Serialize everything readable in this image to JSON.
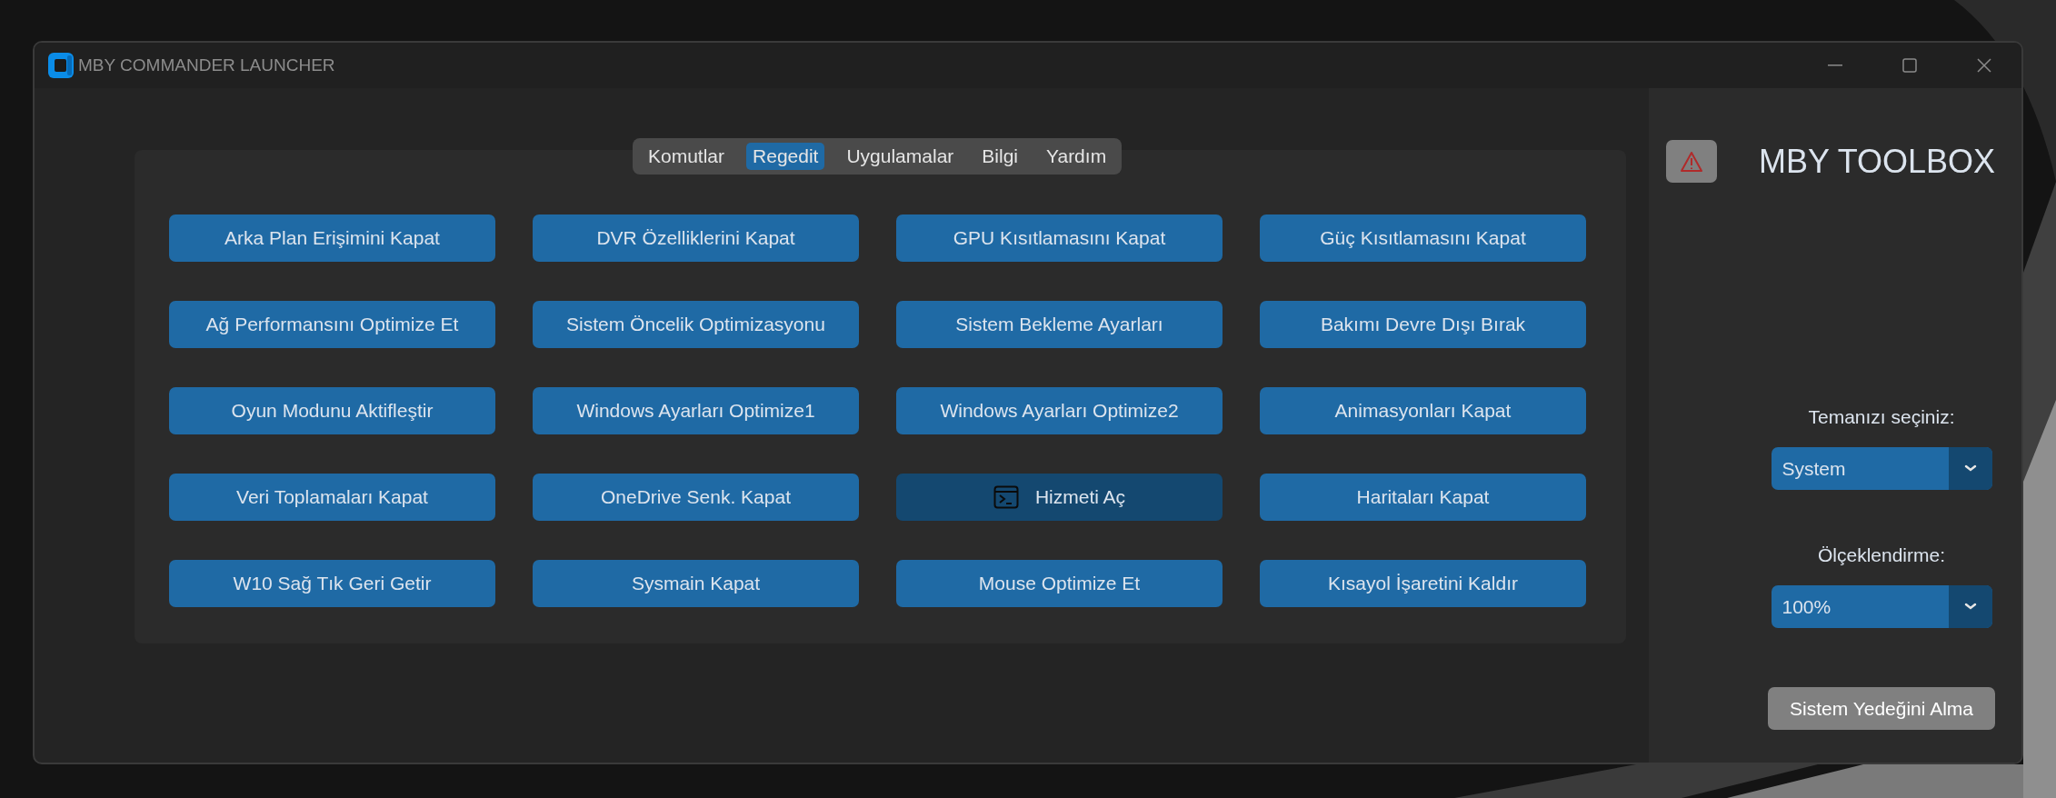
{
  "window": {
    "title": "MBY COMMANDER LAUNCHER"
  },
  "tabs": [
    {
      "label": "Komutlar",
      "selected": false
    },
    {
      "label": "Regedit",
      "selected": true
    },
    {
      "label": "Uygulamalar",
      "selected": false
    },
    {
      "label": "Bilgi",
      "selected": false
    },
    {
      "label": "Yardım",
      "selected": false
    }
  ],
  "buttons": [
    {
      "label": "Arka Plan Erişimini Kapat",
      "kind": "text",
      "highlighted": false
    },
    {
      "label": "DVR Özelliklerini Kapat",
      "kind": "text",
      "highlighted": false
    },
    {
      "label": "GPU Kısıtlamasını Kapat",
      "kind": "text",
      "highlighted": false
    },
    {
      "label": "Güç Kısıtlamasını Kapat",
      "kind": "text",
      "highlighted": false
    },
    {
      "label": "Ağ Performansını Optimize Et",
      "kind": "text",
      "highlighted": false
    },
    {
      "label": "Sistem Öncelik Optimizasyonu",
      "kind": "text",
      "highlighted": false
    },
    {
      "label": "Sistem Bekleme Ayarları",
      "kind": "text",
      "highlighted": false
    },
    {
      "label": "Bakımı Devre Dışı Bırak",
      "kind": "text",
      "highlighted": false
    },
    {
      "label": "Oyun Modunu Aktifleştir",
      "kind": "text",
      "highlighted": false
    },
    {
      "label": "Windows Ayarları Optimize1",
      "kind": "text",
      "highlighted": false
    },
    {
      "label": "Windows Ayarları Optimize2",
      "kind": "text",
      "highlighted": false
    },
    {
      "label": "Animasyonları Kapat",
      "kind": "text",
      "highlighted": false
    },
    {
      "label": "Veri Toplamaları Kapat",
      "kind": "text",
      "highlighted": false
    },
    {
      "label": "OneDrive Senk. Kapat",
      "kind": "text",
      "highlighted": false
    },
    {
      "label": "Hizmeti Aç",
      "kind": "icon",
      "highlighted": true
    },
    {
      "label": "Haritaları Kapat",
      "kind": "text",
      "highlighted": false
    },
    {
      "label": "W10 Sağ Tık Geri Getir",
      "kind": "text",
      "highlighted": false
    },
    {
      "label": "Sysmain Kapat",
      "kind": "text",
      "highlighted": false
    },
    {
      "label": "Mouse Optimize Et",
      "kind": "text",
      "highlighted": false
    },
    {
      "label": "Kısayol İşaretini Kaldır",
      "kind": "text",
      "highlighted": false
    }
  ],
  "sidebar": {
    "title": "MBY TOOLBOX",
    "theme": {
      "label": "Temanızı seçiniz:",
      "value": "System"
    },
    "scaling": {
      "label": "Ölçeklendirme:",
      "value": "100%"
    },
    "backup_button": "Sistem Yedeğini Alma"
  }
}
